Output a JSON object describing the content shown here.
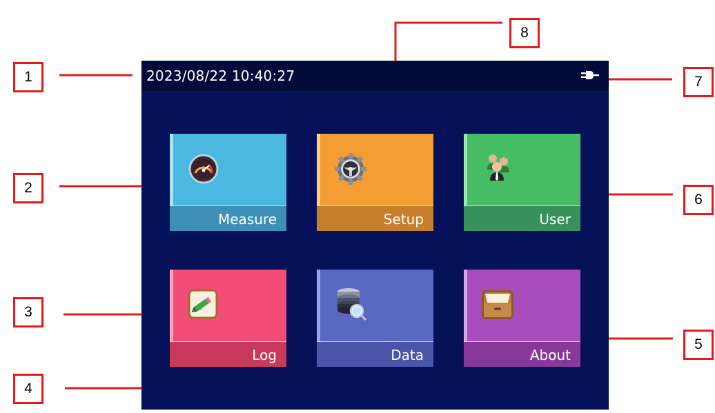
{
  "status_bar": {
    "datetime": "2023/08/22 10:40:27",
    "power_icon": "plug-icon"
  },
  "tiles": [
    {
      "label": "Measure",
      "icon": "gauge-icon",
      "color": "#4ab8e0",
      "lower": "#3d8fb5",
      "strip": "#a9e2f5"
    },
    {
      "label": "Setup",
      "icon": "gear-icon",
      "color": "#f39d32",
      "lower": "#c67f2c",
      "strip": "#ffd08a"
    },
    {
      "label": "User",
      "icon": "users-icon",
      "color": "#46bc64",
      "lower": "#38905a",
      "strip": "#9be5ae"
    },
    {
      "label": "Log",
      "icon": "pencil-icon",
      "color": "#f24d78",
      "lower": "#c93a5a",
      "strip": "#fba3bd"
    },
    {
      "label": "Data",
      "icon": "database-search-icon",
      "color": "#5a68c2",
      "lower": "#4a54a9",
      "strip": "#9aa5e8"
    },
    {
      "label": "About",
      "icon": "drawer-icon",
      "color": "#a84cbe",
      "lower": "#88389b",
      "strip": "#d9a5e7"
    }
  ],
  "callouts": [
    "1",
    "2",
    "3",
    "4",
    "5",
    "6",
    "7",
    "8"
  ],
  "colors": {
    "screen_bg": "#041159",
    "status_bg": "#020b3a",
    "callout_red": "#e31b1b"
  }
}
